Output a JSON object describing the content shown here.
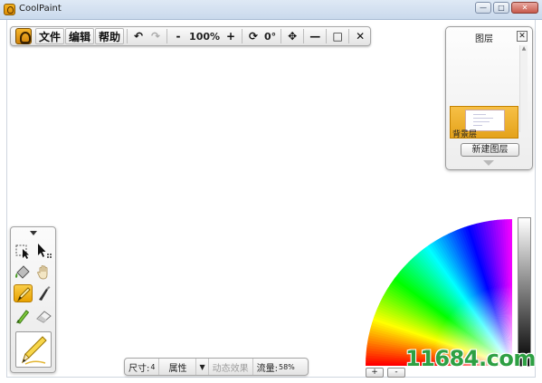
{
  "window": {
    "title": "CoolPaint",
    "minimize": "—",
    "maximize": "□",
    "close": "✕"
  },
  "toolbar": {
    "logo_icon": "coolpaint-logo-icon",
    "menus": [
      "文件",
      "编辑",
      "帮助"
    ],
    "undo": "↶",
    "redo": "↷",
    "zoom_out": "-",
    "zoom_value": "100%",
    "zoom_in": "+",
    "rotate_icon": "⟳",
    "rotation_value": "0°",
    "move_icon": "✥",
    "minimize": "—",
    "maximize": "□",
    "close": "✕"
  },
  "layers_panel": {
    "title": "图层",
    "close": "✕",
    "layers": [
      {
        "name": "背景层",
        "selected": true
      }
    ],
    "new_layer_button": "新建图层"
  },
  "tool_palette": {
    "tools": [
      {
        "name": "selection-tool",
        "active": false
      },
      {
        "name": "move-tool",
        "active": false
      },
      {
        "name": "fill-bucket-tool",
        "active": false
      },
      {
        "name": "hand-tool",
        "active": false
      },
      {
        "name": "pencil-tool",
        "active": true
      },
      {
        "name": "pen-tool",
        "active": false
      },
      {
        "name": "brush-tool",
        "active": false
      },
      {
        "name": "eraser-tool",
        "active": false
      }
    ],
    "current_tool": "pencil-tool"
  },
  "statusbar": {
    "size_label": "尺寸:",
    "size_value": "4",
    "properties_label": "属性",
    "dropdown_icon": "▼",
    "dynamic_effect": "动态效果",
    "flow_label": "流量:",
    "flow_value": "58%"
  },
  "color_picker": {
    "zoom_in_button": "+",
    "zoom_out_button": "-"
  },
  "watermark": "11684.com",
  "colors": {
    "accent": "#f0b21e",
    "watermark": "#2ea043"
  }
}
